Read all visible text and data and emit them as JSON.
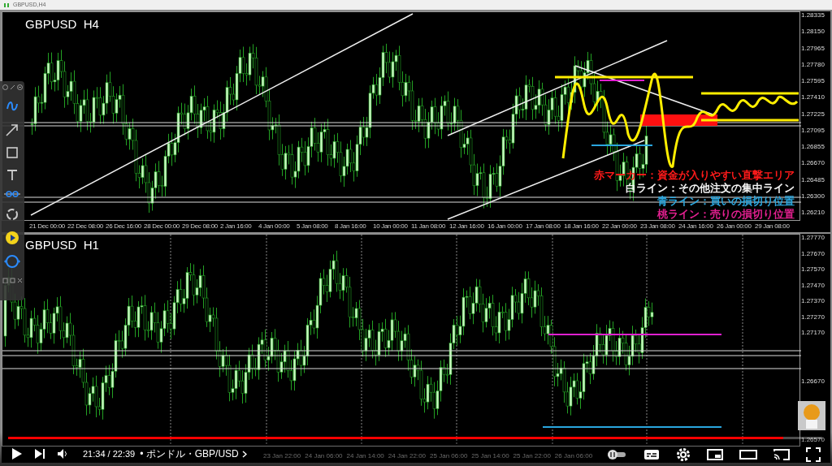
{
  "window": {
    "title": "GBPUSD,H4"
  },
  "top_chart": {
    "title": "GBPUSD  H4",
    "price_labels": [
      "1.28335",
      "1.28150",
      "1.27965",
      "1.27780",
      "1.27595",
      "1.27410",
      "1.27225",
      "1.27095",
      "1.26855",
      "1.26670",
      "1.26485",
      "1.26300",
      "1.26210"
    ],
    "time_labels": [
      "21 Dec 00:00",
      "22 Dec 08:00",
      "26 Dec 16:00",
      "28 Dec 00:00",
      "29 Dec 08:00",
      "2 Jan 16:00",
      "4 Jan 00:00",
      "5 Jan 08:00",
      "8 Jan 16:00",
      "10 Jan 00:00",
      "11 Jan 08:00",
      "12 Jan 16:00",
      "16 Jan 00:00",
      "17 Jan 08:00",
      "18 Jan 16:00",
      "22 Jan 00:00",
      "23 Jan 08:00",
      "24 Jan 16:00",
      "26 Jan 00:00",
      "29 Jan 08:00"
    ],
    "legend": [
      {
        "text": "赤マーカー：資金が入りやすい直撃エリア",
        "color": "#ff1a1a"
      },
      {
        "text": "白ライン：その他注文の集中ライン",
        "color": "#f2f2f2"
      },
      {
        "text": "青ライン：買いの損切り位置",
        "color": "#2aa6de"
      },
      {
        "text": "桃ライン：売りの損切り位置",
        "color": "#e2208f"
      }
    ]
  },
  "bottom_chart": {
    "title": "GBPUSD  H1",
    "price_labels": [
      "1.27770",
      "1.27670",
      "1.27570",
      "1.27470",
      "1.27370",
      "1.27270",
      "1.27170",
      "1.26670",
      "1.26570"
    ],
    "time_labels": [
      "23 Jan 22:00",
      "24 Jan 06:00",
      "24 Jan 14:00",
      "24 Jan 22:00",
      "25 Jan 06:00",
      "25 Jan 14:00",
      "25 Jan 22:00",
      "26 Jan 06:00"
    ]
  },
  "player": {
    "progress": {
      "level": 0.952
    },
    "time": "21:34 / 22:39",
    "chapter": "• ポンドル・GBP/USD"
  }
}
